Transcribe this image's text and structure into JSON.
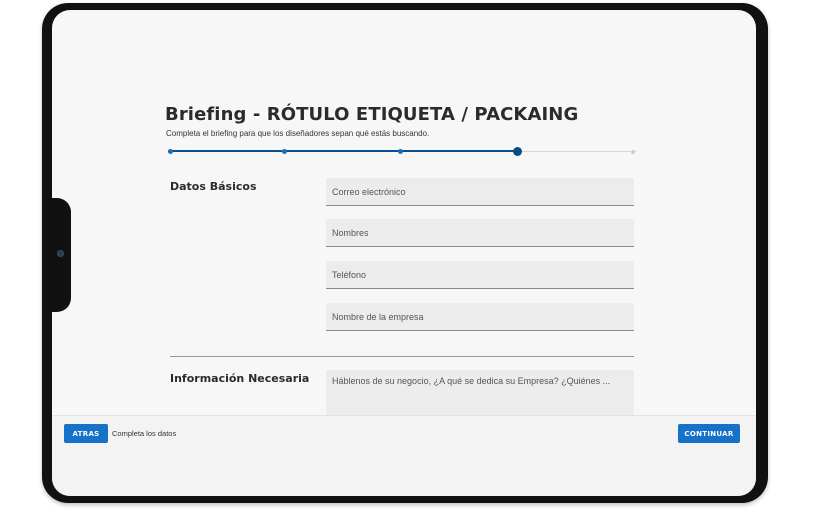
{
  "header": {
    "title": "Briefing - RÓTULO ETIQUETA / PACKAING",
    "subtitle": "Completa el briefing para que los diseñadores sepan qué estás buscando."
  },
  "progress": {
    "total_steps": 5,
    "current_step": 4
  },
  "sections": {
    "basic": {
      "label": "Datos Básicos",
      "fields": {
        "email": {
          "placeholder": "Correo electrónico",
          "value": ""
        },
        "names": {
          "placeholder": "Nombres",
          "value": ""
        },
        "phone": {
          "placeholder": "Teléfono",
          "value": ""
        },
        "company": {
          "placeholder": "Nombre de la empresa",
          "value": ""
        }
      }
    },
    "info": {
      "label": "Información Necesaria",
      "business": {
        "placeholder": "Háblenos de su negocio, ¿A qué se dedica su Empresa? ¿Quiénes ...",
        "value": ""
      }
    }
  },
  "footer": {
    "back_label": "ATRAS",
    "status_text": "Completa los datos",
    "continue_label": "CONTINUAR"
  },
  "colors": {
    "accent": "#1572c8",
    "progress_fill": "#0b4f8a",
    "screen_bg": "#f7f7f7",
    "device_frame": "#111111"
  },
  "icons": {
    "device_camera": "camera-icon"
  }
}
